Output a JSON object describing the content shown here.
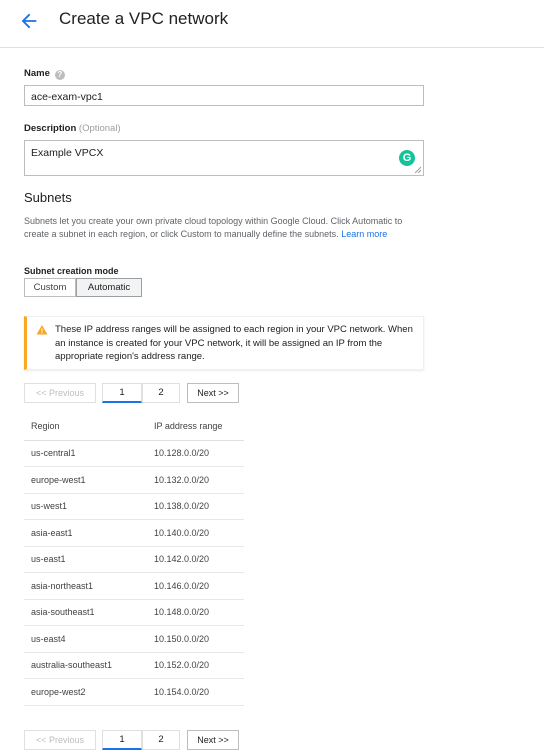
{
  "header": {
    "title": "Create a VPC network"
  },
  "form": {
    "name_label": "Name",
    "help_glyph": "?",
    "name_value": "ace-exam-vpc1",
    "description_label": "Description",
    "description_optional": "(Optional)",
    "description_value": "Example VPCX",
    "grammarly_glyph": "G"
  },
  "subnets": {
    "title": "Subnets",
    "description": "Subnets let you create your own private cloud topology within Google Cloud. Click Automatic to create a subnet in each region, or click Custom to manually define the subnets.",
    "learn_more": "Learn more",
    "mode_label": "Subnet creation mode",
    "mode_options": [
      "Custom",
      "Automatic"
    ],
    "selected_mode": "Automatic"
  },
  "notice": {
    "text": "These IP address ranges will be assigned to each region in your VPC network. When an instance is created for your VPC network, it will be assigned an IP from the appropriate region's address range."
  },
  "pagination": {
    "previous": "<< Previous",
    "pages": [
      "1",
      "2"
    ],
    "current_page": "1",
    "next": "Next >>"
  },
  "table": {
    "columns": [
      "Region",
      "IP address range"
    ],
    "rows": [
      [
        "us-central1",
        "10.128.0.0/20"
      ],
      [
        "europe-west1",
        "10.132.0.0/20"
      ],
      [
        "us-west1",
        "10.138.0.0/20"
      ],
      [
        "asia-east1",
        "10.140.0.0/20"
      ],
      [
        "us-east1",
        "10.142.0.0/20"
      ],
      [
        "asia-northeast1",
        "10.146.0.0/20"
      ],
      [
        "asia-southeast1",
        "10.148.0.0/20"
      ],
      [
        "us-east4",
        "10.150.0.0/20"
      ],
      [
        "australia-southeast1",
        "10.152.0.0/20"
      ],
      [
        "europe-west2",
        "10.154.0.0/20"
      ]
    ]
  },
  "colors": {
    "accent": "#1a73e8",
    "warning": "#f9a825",
    "grammarly": "#15c39a"
  }
}
